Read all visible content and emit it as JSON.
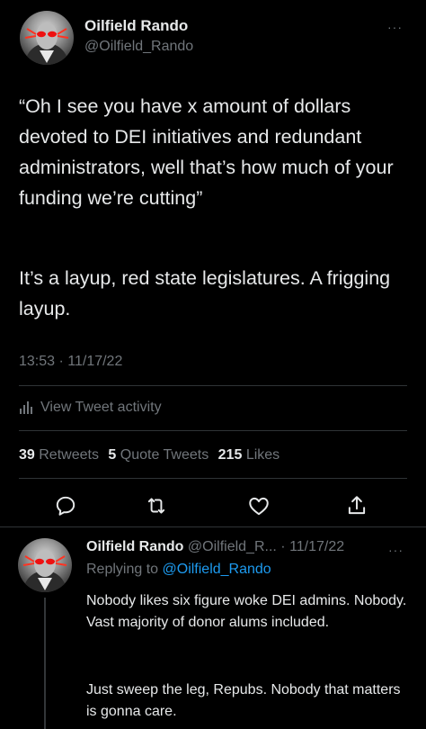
{
  "main_tweet": {
    "author_name": "Oilfield Rando",
    "author_handle": "@Oilfield_Rando",
    "more_label": "···",
    "text_paragraph_1": "“Oh I see you have x amount of dollars devoted to DEI initiatives and redundant administrators, well that’s how much of your funding we’re cutting”",
    "text_paragraph_2": "It’s a layup, red state legislatures. A frigging layup.",
    "timestamp": "13:53 · 11/17/22",
    "activity_label": "View Tweet activity",
    "stats": {
      "retweets_count": "39",
      "retweets_label": "Retweets",
      "quotes_count": "5",
      "quotes_label": "Quote Tweets",
      "likes_count": "215",
      "likes_label": "Likes"
    },
    "actions": [
      "reply-icon",
      "retweet-icon",
      "like-icon",
      "share-icon"
    ]
  },
  "reply_tweet": {
    "author_name": "Oilfield Rando",
    "author_handle": "@Oilfield_R...",
    "date": "· 11/17/22",
    "more_label": "···",
    "replying_to_prefix": "Replying to",
    "replying_to_handle": "@Oilfield_Rando",
    "text_paragraph_1": "Nobody likes six figure woke DEI admins. Nobody. Vast majority of donor alums included.",
    "text_paragraph_2": "Just sweep the leg, Repubs. Nobody that matters is gonna care."
  },
  "colors": {
    "background": "#000000",
    "text": "#e7e9ea",
    "muted": "#71767b",
    "link": "#1d9bf0",
    "divider": "#2f3336"
  }
}
